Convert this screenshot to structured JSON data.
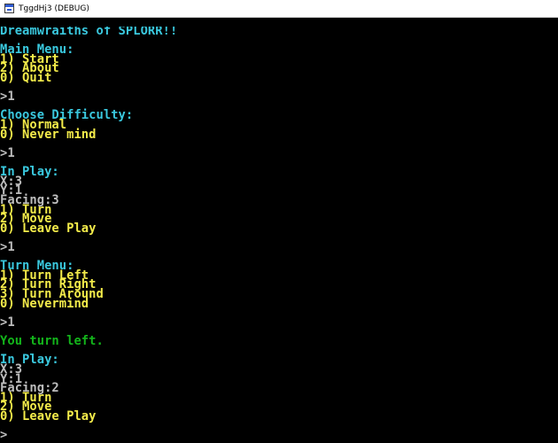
{
  "window": {
    "title": "TggdHj3 (DEBUG)"
  },
  "colors": {
    "title": "#3ac8de",
    "header": "#3ac8de",
    "option": "#f3eb4a",
    "prompt": "#bdbdbd",
    "stat": "#bdbdbd",
    "message": "#13b51b"
  },
  "console": {
    "lines": [
      {
        "text": "Dreamwraiths of SPLORR!!",
        "kind": "title"
      },
      {
        "text": "",
        "kind": "blank"
      },
      {
        "text": "Main Menu:",
        "kind": "header"
      },
      {
        "text": "1) Start",
        "kind": "option"
      },
      {
        "text": "2) About",
        "kind": "option"
      },
      {
        "text": "0) Quit",
        "kind": "option"
      },
      {
        "text": "",
        "kind": "blank"
      },
      {
        "text": ">1",
        "kind": "prompt"
      },
      {
        "text": "",
        "kind": "blank"
      },
      {
        "text": "Choose Difficulty:",
        "kind": "header"
      },
      {
        "text": "1) Normal",
        "kind": "option"
      },
      {
        "text": "0) Never mind",
        "kind": "option"
      },
      {
        "text": "",
        "kind": "blank"
      },
      {
        "text": ">1",
        "kind": "prompt"
      },
      {
        "text": "",
        "kind": "blank"
      },
      {
        "text": "In Play:",
        "kind": "header"
      },
      {
        "text": "X:3",
        "kind": "stat"
      },
      {
        "text": "Y:1",
        "kind": "stat"
      },
      {
        "text": "Facing:3",
        "kind": "stat"
      },
      {
        "text": "1) Turn",
        "kind": "option"
      },
      {
        "text": "2) Move",
        "kind": "option"
      },
      {
        "text": "0) Leave Play",
        "kind": "option"
      },
      {
        "text": "",
        "kind": "blank"
      },
      {
        "text": ">1",
        "kind": "prompt"
      },
      {
        "text": "",
        "kind": "blank"
      },
      {
        "text": "Turn Menu:",
        "kind": "header"
      },
      {
        "text": "1) Turn Left",
        "kind": "option"
      },
      {
        "text": "2) Turn Right",
        "kind": "option"
      },
      {
        "text": "3) Turn Around",
        "kind": "option"
      },
      {
        "text": "0) Nevermind",
        "kind": "option"
      },
      {
        "text": "",
        "kind": "blank"
      },
      {
        "text": ">1",
        "kind": "prompt"
      },
      {
        "text": "",
        "kind": "blank"
      },
      {
        "text": "You turn left.",
        "kind": "message"
      },
      {
        "text": "",
        "kind": "blank"
      },
      {
        "text": "In Play:",
        "kind": "header"
      },
      {
        "text": "X:3",
        "kind": "stat"
      },
      {
        "text": "Y:1",
        "kind": "stat"
      },
      {
        "text": "Facing:2",
        "kind": "stat"
      },
      {
        "text": "1) Turn",
        "kind": "option"
      },
      {
        "text": "2) Move",
        "kind": "option"
      },
      {
        "text": "0) Leave Play",
        "kind": "option"
      },
      {
        "text": "",
        "kind": "blank"
      },
      {
        "text": ">",
        "kind": "prompt"
      }
    ]
  }
}
